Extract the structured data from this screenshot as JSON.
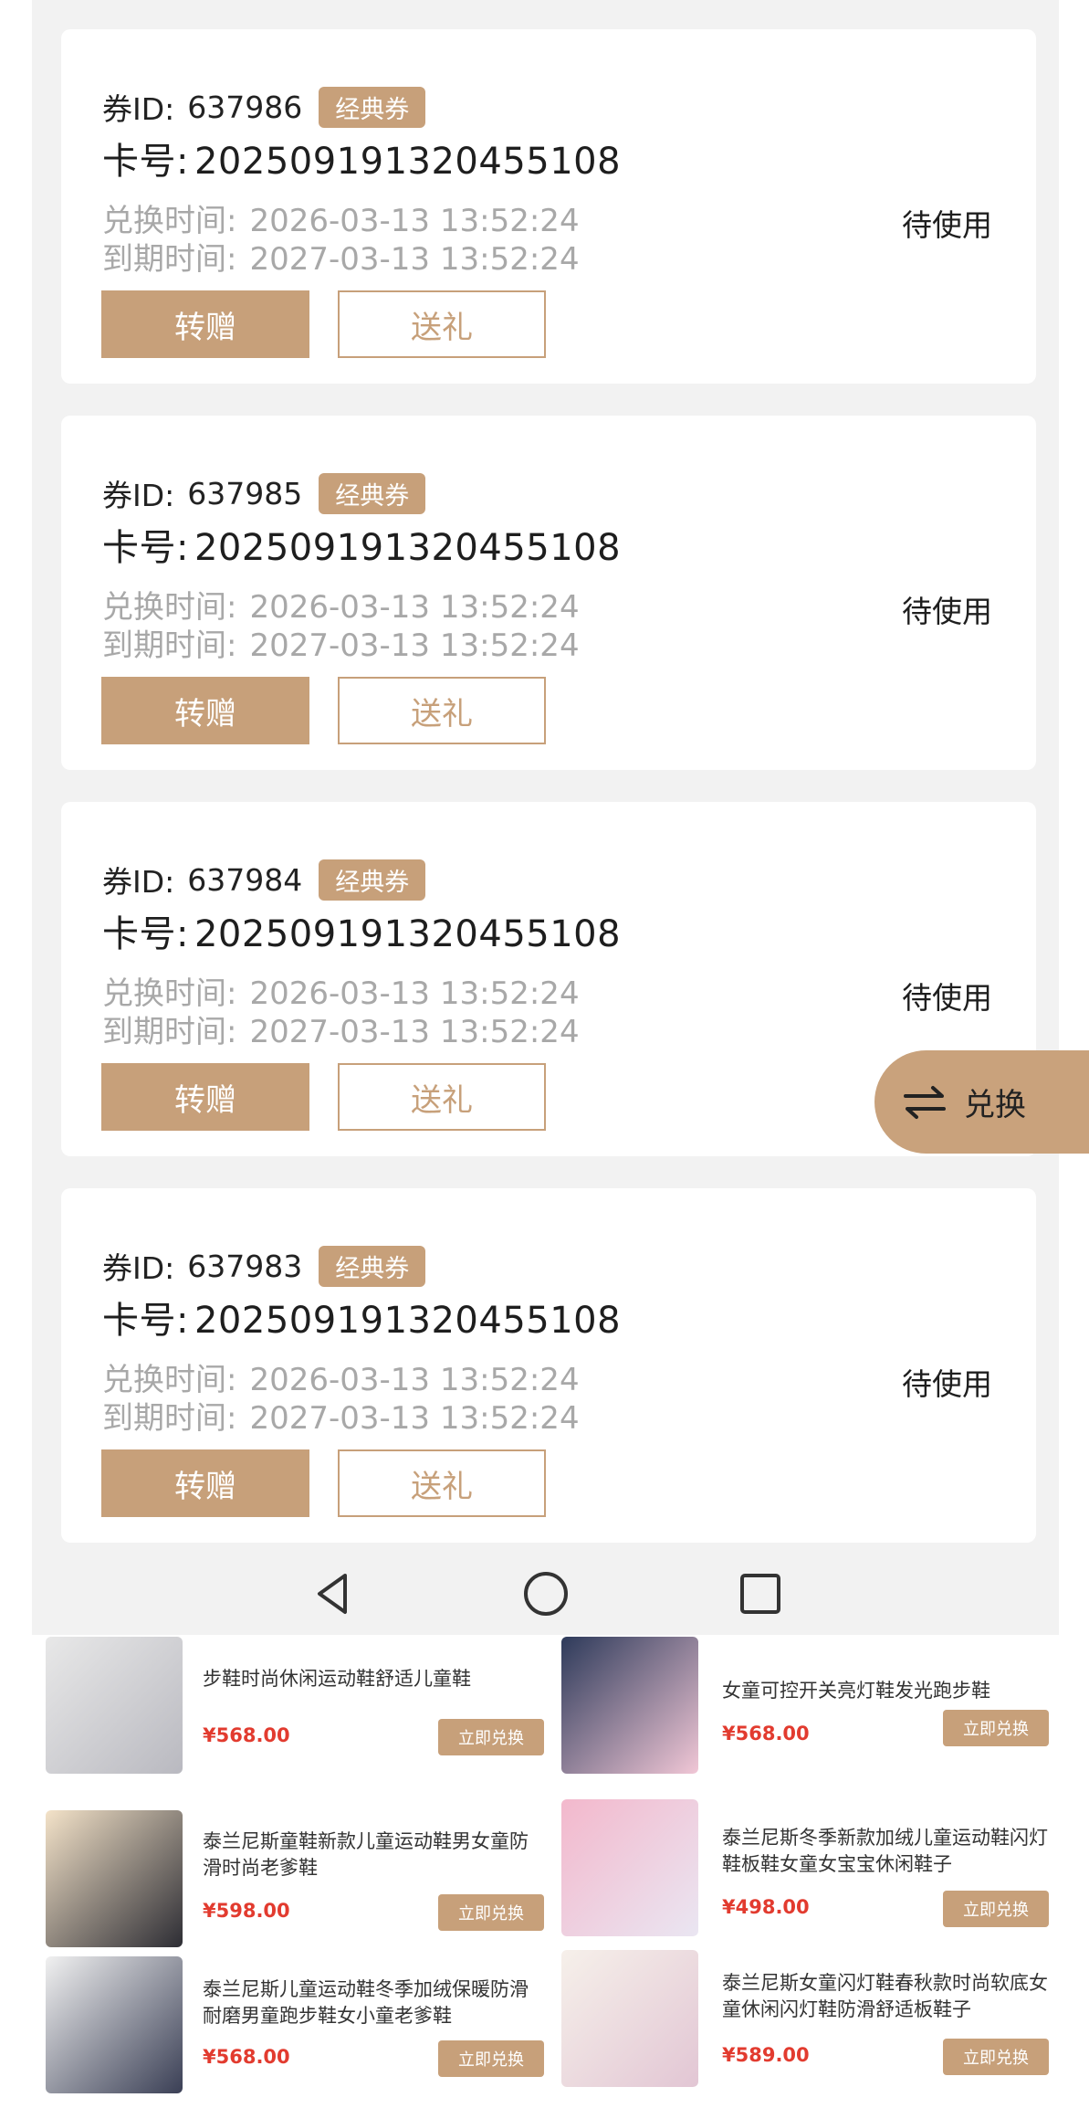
{
  "coupons": [
    {
      "id_label": "券ID:",
      "id": "637986",
      "tag": "经典券",
      "card_label": "卡号:",
      "card_no": "20250919132045510‌8",
      "redeem_label": "兑换时间:",
      "redeem_time": "2026-03-13 13:52:24",
      "expire_label": "到期时间:",
      "expire_time": "2027-03-13 13:52:24",
      "status": "待使用",
      "transfer_label": "转赠",
      "gift_label": "送礼"
    },
    {
      "id_label": "券ID:",
      "id": "637985",
      "tag": "经典券",
      "card_label": "卡号:",
      "card_no": "20250919132045510‌8",
      "redeem_label": "兑换时间:",
      "redeem_time": "2026-03-13 13:52:24",
      "expire_label": "到期时间:",
      "expire_time": "2027-03-13 13:52:24",
      "status": "待使用",
      "transfer_label": "转赠",
      "gift_label": "送礼"
    },
    {
      "id_label": "券ID:",
      "id": "637984",
      "tag": "经典券",
      "card_label": "卡号:",
      "card_no": "20250919132045510‌8",
      "redeem_label": "兑换时间:",
      "redeem_time": "2026-03-13 13:52:24",
      "expire_label": "到期时间:",
      "expire_time": "2027-03-13 13:52:24",
      "status": "待使用",
      "transfer_label": "转赠",
      "gift_label": "送礼"
    },
    {
      "id_label": "券ID:",
      "id": "637983",
      "tag": "经典券",
      "card_label": "卡号:",
      "card_no": "20250919132045510‌8",
      "redeem_label": "兑换时间:",
      "redeem_time": "2026-03-13 13:52:24",
      "expire_label": "到期时间:",
      "expire_time": "2027-03-13 13:52:24",
      "status": "待使用",
      "transfer_label": "转赠",
      "gift_label": "送礼"
    }
  ],
  "fab": {
    "label": "兑换",
    "icon": "swap-arrows-icon"
  },
  "navbar": {
    "back_icon": "back-triangle-icon",
    "home_icon": "home-circle-icon",
    "recents_icon": "recents-square-icon"
  },
  "products": [
    {
      "title": "步鞋时尚休闲运动鞋舒适儿童鞋",
      "price": "¥568.00",
      "button": "立即兑换"
    },
    {
      "title": "女童可控开关亮灯鞋发光跑步鞋",
      "price": "¥568.00",
      "button": "立即兑换"
    },
    {
      "title": "泰兰尼斯童鞋新款儿童运动鞋男女童防滑时尚老爹鞋",
      "price": "¥598.00",
      "button": "立即兑换"
    },
    {
      "title": "泰兰尼斯冬季新款加绒儿童运动鞋闪灯鞋板鞋女童女宝宝休闲鞋子",
      "price": "¥498.00",
      "button": "立即兑换"
    },
    {
      "title": "泰兰尼斯儿童运动鞋冬季加绒保暖防滑耐磨男童跑步鞋女小童老爹鞋",
      "price": "¥568.00",
      "button": "立即兑换"
    },
    {
      "title": "泰兰尼斯女童闪灯鞋春秋款时尚软底女童休闲闪灯鞋防滑舒适板鞋子",
      "price": "¥589.00",
      "button": "立即兑换"
    }
  ]
}
